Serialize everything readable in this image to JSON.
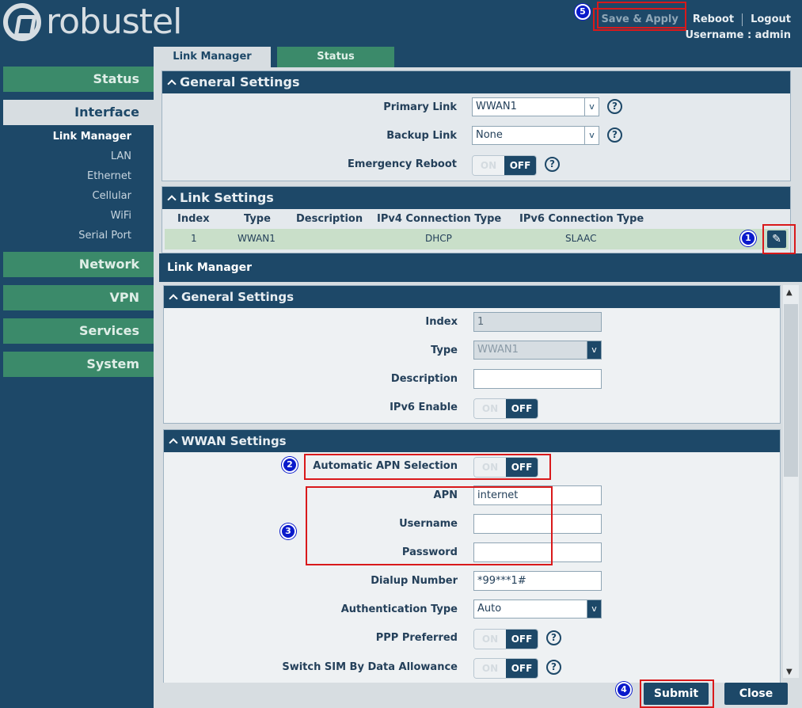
{
  "header": {
    "logo_text": "robustel",
    "save_apply": "Save & Apply",
    "reboot": "Reboot",
    "logout": "Logout",
    "username": "Username : admin"
  },
  "sidebar": {
    "items": [
      {
        "label": "Status"
      },
      {
        "label": "Interface"
      },
      {
        "label": "Network"
      },
      {
        "label": "VPN"
      },
      {
        "label": "Services"
      },
      {
        "label": "System"
      }
    ],
    "sub_items": [
      "Link Manager",
      "LAN",
      "Ethernet",
      "Cellular",
      "WiFi",
      "Serial Port"
    ]
  },
  "tabs": [
    "Link Manager",
    "Status"
  ],
  "general_settings": {
    "title": "General Settings",
    "primary_link_label": "Primary Link",
    "primary_link_value": "WWAN1",
    "backup_link_label": "Backup Link",
    "backup_link_value": "None",
    "emergency_reboot_label": "Emergency Reboot",
    "toggle_on": "ON",
    "toggle_off": "OFF",
    "help": "?"
  },
  "link_settings": {
    "title": "Link Settings",
    "columns": [
      "Index",
      "Type",
      "Description",
      "IPv4 Connection Type",
      "IPv6 Connection Type"
    ],
    "rows": [
      {
        "index": "1",
        "type": "WWAN1",
        "description": "",
        "ipv4": "DHCP",
        "ipv6": "SLAAC"
      }
    ]
  },
  "modal": {
    "title": "Link Manager",
    "general": {
      "title": "General Settings",
      "index_label": "Index",
      "index_value": "1",
      "type_label": "Type",
      "type_value": "WWAN1",
      "description_label": "Description",
      "description_value": "",
      "ipv6_label": "IPv6 Enable"
    },
    "wwan": {
      "title": "WWAN Settings",
      "auto_apn_label": "Automatic APN Selection",
      "apn_label": "APN",
      "apn_value": "internet",
      "username_label": "Username",
      "username_value": "",
      "password_label": "Password",
      "password_value": "",
      "dialup_label": "Dialup Number",
      "dialup_value": "*99***1#",
      "auth_label": "Authentication Type",
      "auth_value": "Auto",
      "ppp_label": "PPP Preferred",
      "switch_sim_label": "Switch SIM By Data Allowance"
    },
    "submit": "Submit",
    "close": "Close"
  },
  "annotations": [
    "1",
    "2",
    "3",
    "4",
    "5"
  ],
  "colors": {
    "navy": "#1d4868",
    "green": "#3b8a6a",
    "panel": "#d7dde1",
    "highlight_red": "#d9191b",
    "badge_blue": "#0a1acb"
  }
}
